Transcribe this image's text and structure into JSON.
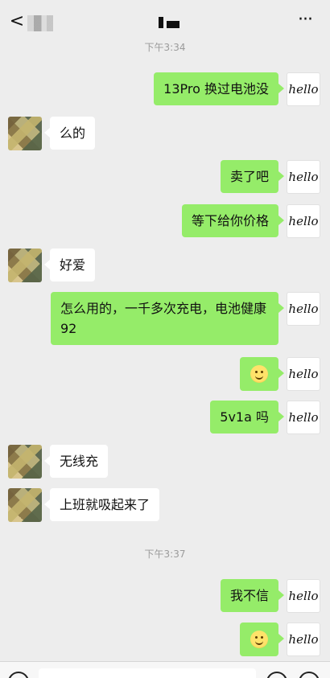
{
  "header": {
    "back": "<",
    "title": "",
    "more": "···"
  },
  "timestamps": [
    "下午3:34",
    "下午3:37"
  ],
  "avatar_me_text": "hello",
  "messages": [
    {
      "side": "me",
      "text": "13Pro 换过电池没"
    },
    {
      "side": "other",
      "text": "么的"
    },
    {
      "side": "me",
      "text": "卖了吧"
    },
    {
      "side": "me",
      "text": "等下给你价格"
    },
    {
      "side": "other",
      "text": "好爱"
    },
    {
      "side": "me",
      "text": "怎么用的，一千多次充电，电池健康 92"
    },
    {
      "side": "me",
      "text": ""
    },
    {
      "side": "me",
      "text": "5v1a 吗"
    },
    {
      "side": "other",
      "text": "无线充"
    },
    {
      "side": "other",
      "text": "上班就吸起来了"
    },
    {
      "side": "me",
      "text": "我不信"
    },
    {
      "side": "me",
      "text": ""
    }
  ],
  "icons": {
    "back": "back-icon",
    "more": "more-icon",
    "emoji": "smile-emoji-icon"
  },
  "colors": {
    "background": "#ededed",
    "me_bubble": "#95ec69",
    "other_bubble": "#ffffff"
  }
}
